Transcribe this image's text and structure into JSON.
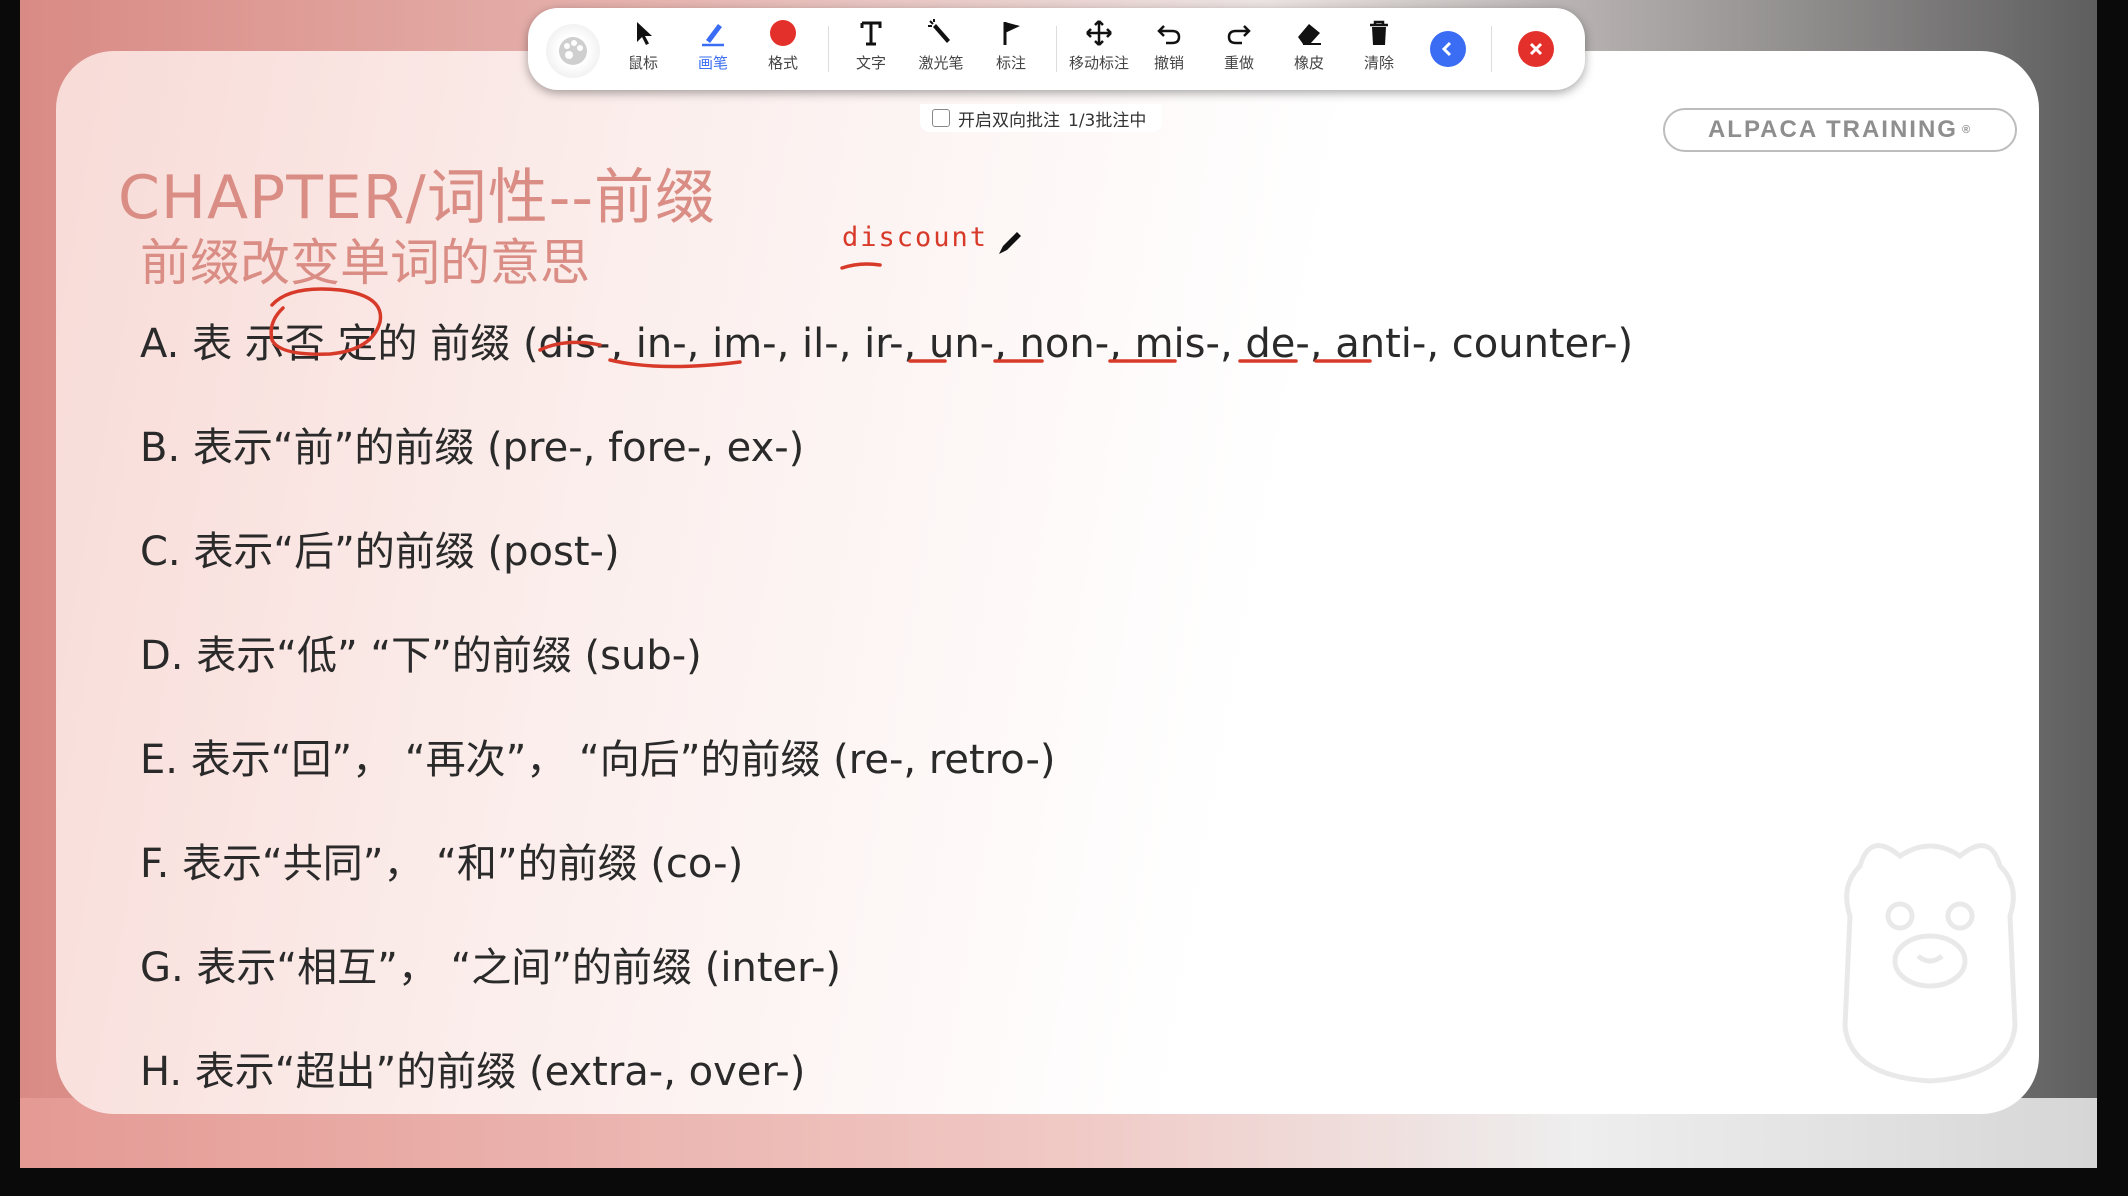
{
  "toolbar": {
    "tools": [
      {
        "label": "鼠标",
        "icon": "pointer-icon"
      },
      {
        "label": "画笔",
        "icon": "brush-icon",
        "active": true
      },
      {
        "label": "格式",
        "icon": "color-dot-icon",
        "color": "#e4302b"
      },
      {
        "label": "文字",
        "icon": "text-icon"
      },
      {
        "label": "激光笔",
        "icon": "laser-pen-icon"
      },
      {
        "label": "标注",
        "icon": "flag-icon"
      },
      {
        "label": "移动标注",
        "icon": "move-icon"
      },
      {
        "label": "撤销",
        "icon": "undo-icon"
      },
      {
        "label": "重做",
        "icon": "redo-icon"
      },
      {
        "label": "橡皮",
        "icon": "eraser-icon"
      },
      {
        "label": "清除",
        "icon": "trash-icon"
      }
    ],
    "collapse_icon": "chevron-left-icon",
    "close_icon": "close-icon"
  },
  "annotation_bar": {
    "checkbox_label": "开启双向批注",
    "status": "1/3批注中"
  },
  "slide": {
    "chapter_title": "CHAPTER/词性--前缀",
    "brand": "ALPACA TRAINING",
    "brand_mark": "®",
    "subtitle": "前缀改变单词的意思",
    "handwriting": "discount",
    "items": [
      "A. 表 示否 定的 前缀 (dis-, in-, im-, il-, ir-, un-, non-, mis-, de-, anti-, counter-)",
      "B. 表示“前”的前缀 (pre-, fore-, ex-)",
      "C. 表示“后”的前缀 (post-)",
      "D. 表示“低” “下”的前缀 (sub-)",
      "E. 表示“回”， “再次”， “向后”的前缀 (re-, retro-)",
      "F. 表示“共同”， “和”的前缀 (co-)",
      "G. 表示“相互”， “之间”的前缀 (inter-)",
      "H. 表示“超出”的前缀 (extra-, over-)"
    ]
  },
  "colors": {
    "accent_title": "#d98d84",
    "ink_red": "#d83a2a",
    "active_tool": "#3a6cf4"
  }
}
